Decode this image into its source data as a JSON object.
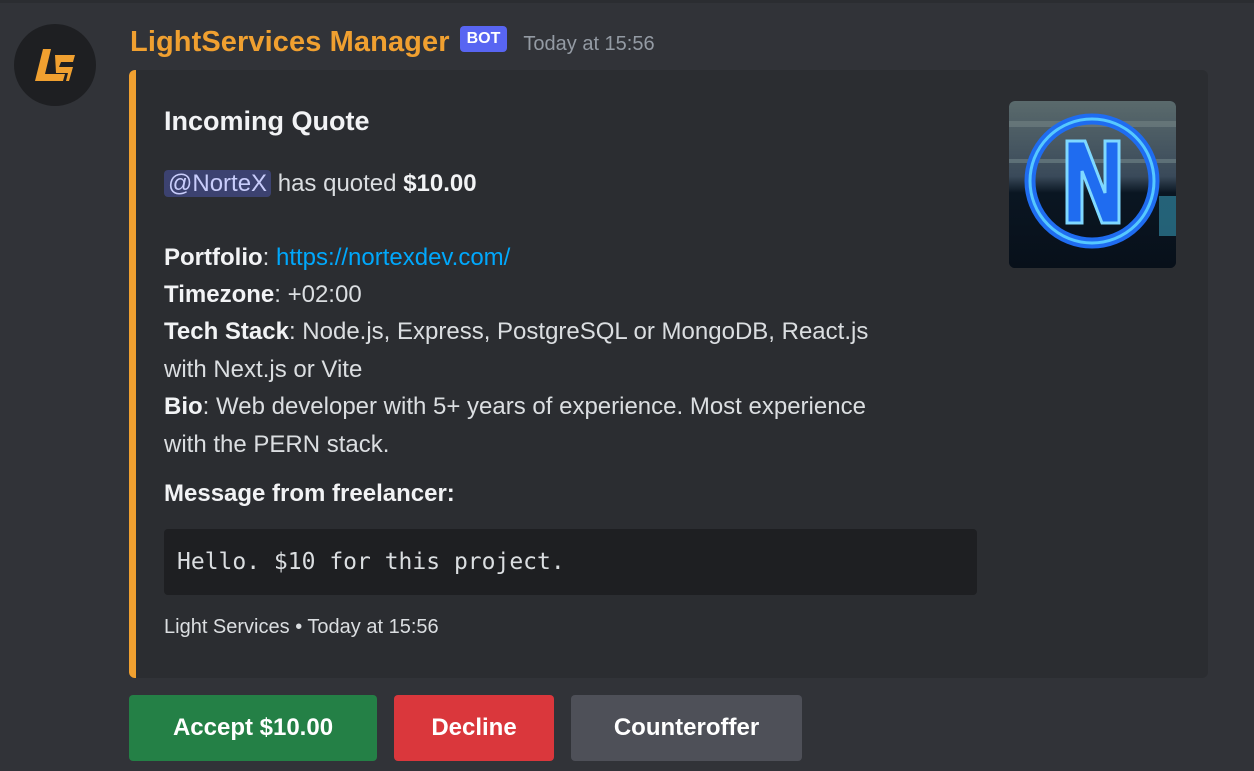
{
  "message": {
    "author": "LightServices Manager",
    "bot_tag": "BOT",
    "timestamp": "Today at 15:56",
    "avatar_icon": "lightservices-logo-icon"
  },
  "embed": {
    "accent_color": "#f0a030",
    "title": "Incoming Quote",
    "mention": "@NorteX",
    "quote_text": "has quoted",
    "quote_amount": "$10.00",
    "portfolio_label": "Portfolio",
    "portfolio_url": "https://nortexdev.com/",
    "timezone_label": "Timezone",
    "timezone_value": "+02:00",
    "tech_label": "Tech Stack",
    "tech_value_line1": "Node.js, Express, PostgreSQL or MongoDB, React.js",
    "tech_value_line2": "with Next.js or Vite",
    "bio_label": "Bio",
    "bio_value_line1": "Web developer with 5+ years of experience. Most experience",
    "bio_value_line2": "with the PERN stack.",
    "message_label": "Message from freelancer:",
    "message_code": "Hello. $10 for this project.",
    "footer_text": "Light Services",
    "footer_separator": "•",
    "footer_time": "Today at 15:56",
    "thumbnail_icon": "nortex-logo-icon"
  },
  "buttons": {
    "accept": "Accept $10.00",
    "decline": "Decline",
    "counteroffer": "Counteroffer"
  },
  "colors": {
    "accept": "#248046",
    "decline": "#da373c",
    "counteroffer": "#4e5058",
    "username": "#f0a030",
    "bot_tag": "#5865f2",
    "link": "#00a8fc"
  }
}
